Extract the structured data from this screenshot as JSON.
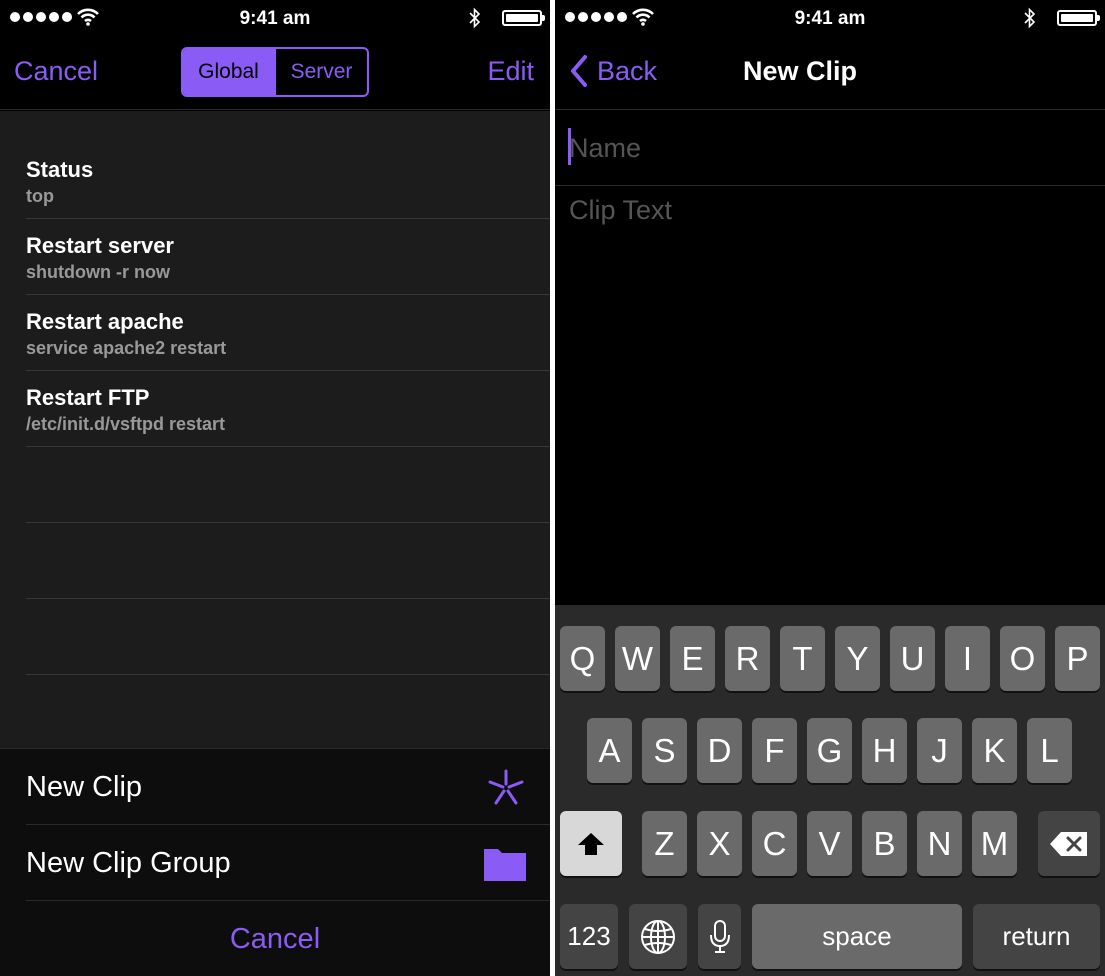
{
  "status_bar": {
    "time": "9:41 am"
  },
  "left": {
    "nav": {
      "cancel_label": "Cancel",
      "edit_label": "Edit",
      "segments": [
        "Global",
        "Server"
      ],
      "selected_segment": "Global"
    },
    "clips": [
      {
        "title": "Status",
        "command": "top"
      },
      {
        "title": "Restart server",
        "command": "shutdown -r now"
      },
      {
        "title": "Restart apache",
        "command": "service apache2 restart"
      },
      {
        "title": "Restart FTP",
        "command": "/etc/init.d/vsftpd restart"
      }
    ],
    "sheet": {
      "new_clip_label": "New Clip",
      "new_group_label": "New Clip Group",
      "cancel_label": "Cancel"
    }
  },
  "right": {
    "nav": {
      "back_label": "Back",
      "title": "New Clip"
    },
    "name_placeholder": "Name",
    "clip_text_placeholder": "Clip Text",
    "keyboard": {
      "row1": [
        "Q",
        "W",
        "E",
        "R",
        "T",
        "Y",
        "U",
        "I",
        "O",
        "P"
      ],
      "row2": [
        "A",
        "S",
        "D",
        "F",
        "G",
        "H",
        "J",
        "K",
        "L"
      ],
      "row3": [
        "Z",
        "X",
        "C",
        "V",
        "B",
        "N",
        "M"
      ],
      "numbers_label": "123",
      "space_label": "space",
      "return_label": "return"
    }
  },
  "colors": {
    "accent": "#8a5cf5",
    "background": "#000000",
    "list_background": "#1c1c1c"
  }
}
